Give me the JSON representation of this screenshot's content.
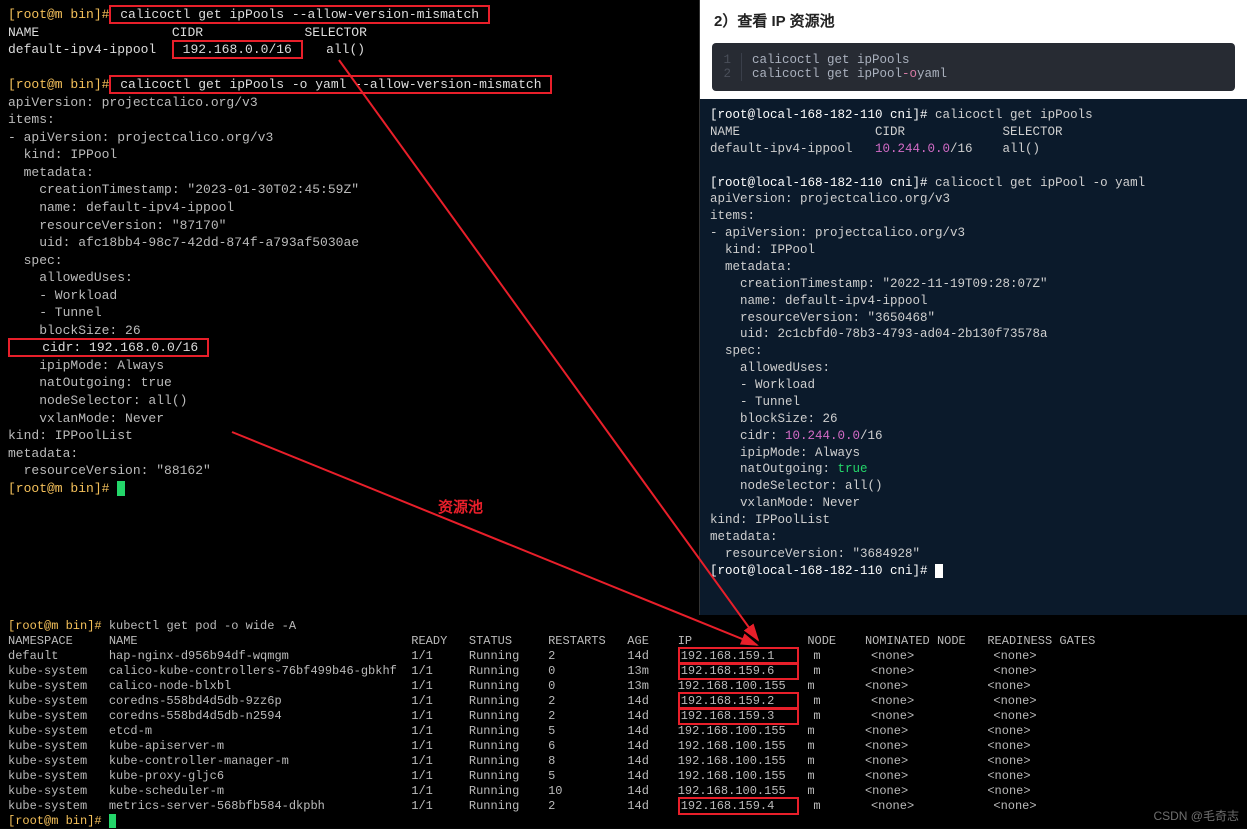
{
  "left": {
    "prompt1": "[root@m bin]#",
    "cmd1": " calicoctl get ipPools --allow-version-mismatch ",
    "header_name": "NAME",
    "header_cidr": "CIDR",
    "header_sel": "SELECTOR",
    "row_name": "default-ipv4-ippool",
    "row_cidr": " 192.168.0.0/16 ",
    "row_sel": "all()",
    "prompt2": "[root@m bin]#",
    "cmd2": " calicoctl get ipPools -o yaml --allow-version-mismatch ",
    "yaml": [
      "apiVersion: projectcalico.org/v3",
      "items:",
      "- apiVersion: projectcalico.org/v3",
      "  kind: IPPool",
      "  metadata:",
      "    creationTimestamp: \"2023-01-30T02:45:59Z\"",
      "    name: default-ipv4-ippool",
      "    resourceVersion: \"87170\"",
      "    uid: afc18bb4-98c7-42dd-874f-a793af5030ae",
      "  spec:",
      "    allowedUses:",
      "    - Workload",
      "    - Tunnel",
      "    blockSize: 26"
    ],
    "cidr_line": "    cidr: 192.168.0.0/16 ",
    "yaml2": [
      "    ipipMode: Always",
      "    natOutgoing: true",
      "    nodeSelector: all()",
      "    vxlanMode: Never",
      "kind: IPPoolList",
      "metadata:",
      "  resourceVersion: \"88162\""
    ],
    "prompt3": "[root@m bin]# ",
    "annotation": "资源池"
  },
  "right": {
    "heading": "2）查看 IP 资源池",
    "code": {
      "l1": "calicoctl get ipPools",
      "l2a": "calicoctl get ipPool ",
      "l2b": "-o",
      "l2c": " yaml"
    },
    "term": {
      "prompt1": "[root@local-168-182-110 cni]# ",
      "cmd1": "calicoctl get ipPools",
      "hdr": "NAME                  CIDR             SELECTOR",
      "row_a": "default-ipv4-ippool   ",
      "row_cidr": "10.244.0.0",
      "row_b": "/16    all()",
      "prompt2": "[root@local-168-182-110 cni]# ",
      "cmd2": "calicoctl get ipPool -o yaml",
      "y": [
        "apiVersion: projectcalico.org/v3",
        "items:",
        "- apiVersion: projectcalico.org/v3",
        "  kind: IPPool",
        "  metadata:",
        "    creationTimestamp: \"2022-11-19T09:28:07Z\"",
        "    name: default-ipv4-ippool",
        "    resourceVersion: \"3650468\"",
        "    uid: 2c1cbfd0-78b3-4793-ad04-2b130f73578a",
        "  spec:",
        "    allowedUses:",
        "    - Workload",
        "    - Tunnel",
        "    blockSize: 26"
      ],
      "cidr_a": "    cidr: ",
      "cidr_b": "10.244.0.0",
      "cidr_c": "/16",
      "y2a": "    ipipMode: Always",
      "y2b_a": "    natOutgoing: ",
      "y2b_b": "true",
      "y2c": "    nodeSelector: all()",
      "y2d": "    vxlanMode: Never",
      "y2e": "kind: IPPoolList",
      "y2f": "metadata:",
      "y2g": "  resourceVersion: \"3684928\"",
      "prompt3": "[root@local-168-182-110 cni]# "
    }
  },
  "bottom": {
    "prompt": "[root@m bin]# ",
    "cmd": "kubectl get pod -o wide -A",
    "cols": [
      "NAMESPACE",
      "NAME",
      "READY",
      "STATUS",
      "RESTARTS",
      "AGE",
      "IP",
      "NODE",
      "NOMINATED NODE",
      "READINESS GATES"
    ],
    "rows": [
      {
        "ns": "default",
        "name": "hap-nginx-d956b94df-wqmgm",
        "ready": "1/1",
        "status": "Running",
        "restarts": "2",
        "age": "14d",
        "ip": "192.168.159.1",
        "node": "m",
        "nom": "<none>",
        "rg": "<none>",
        "box": 1
      },
      {
        "ns": "kube-system",
        "name": "calico-kube-controllers-76bf499b46-gbkhf",
        "ready": "1/1",
        "status": "Running",
        "restarts": "0",
        "age": "13m",
        "ip": "192.168.159.6",
        "node": "m",
        "nom": "<none>",
        "rg": "<none>",
        "box": 1
      },
      {
        "ns": "kube-system",
        "name": "calico-node-blxbl",
        "ready": "1/1",
        "status": "Running",
        "restarts": "0",
        "age": "13m",
        "ip": "192.168.100.155",
        "node": "m",
        "nom": "<none>",
        "rg": "<none>",
        "box": 0
      },
      {
        "ns": "kube-system",
        "name": "coredns-558bd4d5db-9zz6p",
        "ready": "1/1",
        "status": "Running",
        "restarts": "2",
        "age": "14d",
        "ip": "192.168.159.2",
        "node": "m",
        "nom": "<none>",
        "rg": "<none>",
        "box": 2
      },
      {
        "ns": "kube-system",
        "name": "coredns-558bd4d5db-n2594",
        "ready": "1/1",
        "status": "Running",
        "restarts": "2",
        "age": "14d",
        "ip": "192.168.159.3",
        "node": "m",
        "nom": "<none>",
        "rg": "<none>",
        "box": 2
      },
      {
        "ns": "kube-system",
        "name": "etcd-m",
        "ready": "1/1",
        "status": "Running",
        "restarts": "5",
        "age": "14d",
        "ip": "192.168.100.155",
        "node": "m",
        "nom": "<none>",
        "rg": "<none>",
        "box": 0
      },
      {
        "ns": "kube-system",
        "name": "kube-apiserver-m",
        "ready": "1/1",
        "status": "Running",
        "restarts": "6",
        "age": "14d",
        "ip": "192.168.100.155",
        "node": "m",
        "nom": "<none>",
        "rg": "<none>",
        "box": 0
      },
      {
        "ns": "kube-system",
        "name": "kube-controller-manager-m",
        "ready": "1/1",
        "status": "Running",
        "restarts": "8",
        "age": "14d",
        "ip": "192.168.100.155",
        "node": "m",
        "nom": "<none>",
        "rg": "<none>",
        "box": 0
      },
      {
        "ns": "kube-system",
        "name": "kube-proxy-gljc6",
        "ready": "1/1",
        "status": "Running",
        "restarts": "5",
        "age": "14d",
        "ip": "192.168.100.155",
        "node": "m",
        "nom": "<none>",
        "rg": "<none>",
        "box": 0
      },
      {
        "ns": "kube-system",
        "name": "kube-scheduler-m",
        "ready": "1/1",
        "status": "Running",
        "restarts": "10",
        "age": "14d",
        "ip": "192.168.100.155",
        "node": "m",
        "nom": "<none>",
        "rg": "<none>",
        "box": 0
      },
      {
        "ns": "kube-system",
        "name": "metrics-server-568bfb584-dkpbh",
        "ready": "1/1",
        "status": "Running",
        "restarts": "2",
        "age": "14d",
        "ip": "192.168.159.4",
        "node": "m",
        "nom": "<none>",
        "rg": "<none>",
        "box": 3
      }
    ],
    "prompt2": "[root@m bin]# "
  },
  "watermark": "CSDN @毛奇志"
}
